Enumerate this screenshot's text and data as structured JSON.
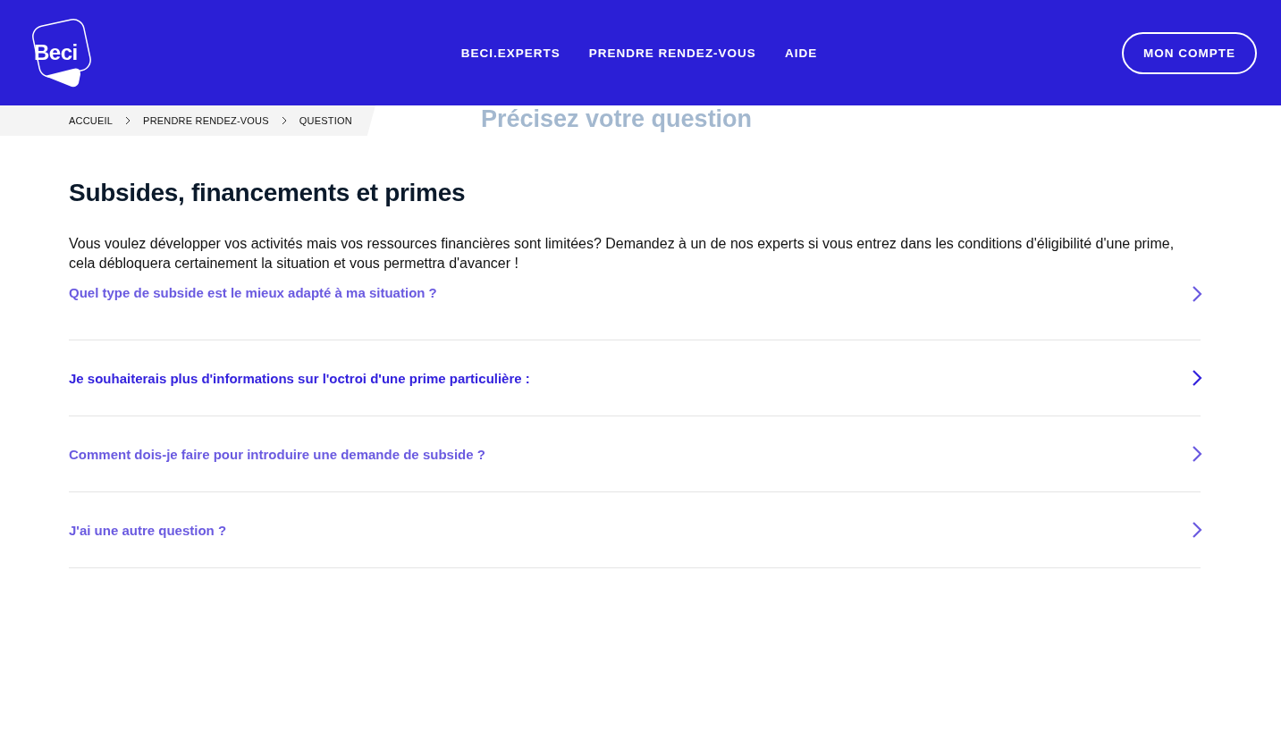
{
  "header": {
    "logo": "Beci",
    "nav": [
      {
        "label": "BECI.EXPERTS"
      },
      {
        "label": "PRENDRE RENDEZ-VOUS"
      },
      {
        "label": "AIDE"
      }
    ],
    "account_button": "MON COMPTE"
  },
  "breadcrumb": [
    {
      "label": "ACCUEIL"
    },
    {
      "label": "PRENDRE RENDEZ-VOUS"
    },
    {
      "label": "QUESTION"
    }
  ],
  "page_title": "Précisez votre question",
  "section": {
    "title": "Subsides, financements et primes",
    "description": "Vous voulez développer vos activités mais vos ressources financières sont limitées? Demandez à un de nos experts si vous entrez dans les conditions d'éligibilité d'une prime, cela débloquera certainement la situation et vous permettra d'avancer !",
    "questions": [
      {
        "label": "Quel type de subside est le mieux adapté à ma situation ?",
        "selected": false
      },
      {
        "label": "Je souhaiterais plus d'informations sur l'octroi d'une prime particulière :",
        "selected": true
      },
      {
        "label": "Comment dois-je faire pour introduire une demande de subside ?",
        "selected": false
      },
      {
        "label": "J'ai une autre question ?",
        "selected": false
      }
    ]
  }
}
